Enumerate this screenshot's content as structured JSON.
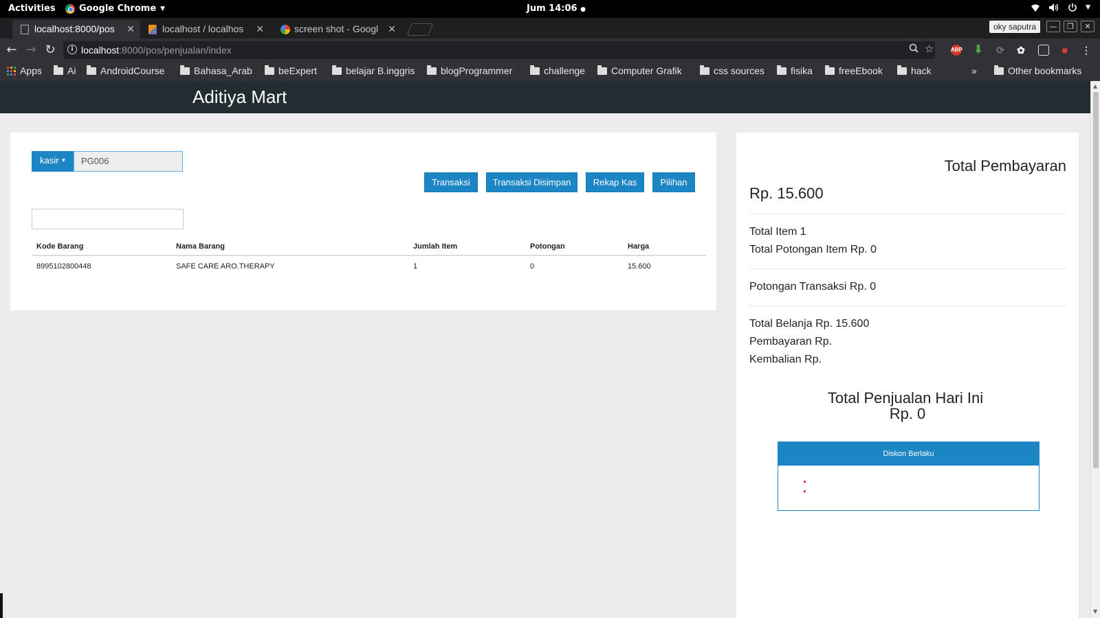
{
  "os": {
    "activities": "Activities",
    "app_name": "Google Chrome",
    "clock": "Jum 14:06"
  },
  "browser": {
    "tabs": [
      {
        "title": "localhost:8000/pos",
        "active": true,
        "icon": "document-icon"
      },
      {
        "title": "localhost / localhos",
        "active": false,
        "icon": "phpmyadmin-icon"
      },
      {
        "title": "screen shot - Googl",
        "active": false,
        "icon": "google-icon"
      }
    ],
    "profile": "oky saputra",
    "url_host": "localhost",
    "url_rest": ":8000/pos/penjualan/index",
    "bookmarks": [
      {
        "label": "Apps",
        "type": "apps"
      },
      {
        "label": "Ai",
        "type": "folder"
      },
      {
        "label": "AndroidCourse",
        "type": "folder"
      },
      {
        "label": "Bahasa_Arab",
        "type": "folder"
      },
      {
        "label": "beExpert",
        "type": "folder"
      },
      {
        "label": "belajar B.inggris",
        "type": "folder"
      },
      {
        "label": "blogProgrammer",
        "type": "folder"
      },
      {
        "label": "challenge",
        "type": "folder"
      },
      {
        "label": "Computer Grafik",
        "type": "folder"
      },
      {
        "label": "css sources",
        "type": "folder"
      },
      {
        "label": "fisika",
        "type": "folder"
      },
      {
        "label": "freeEbook",
        "type": "folder"
      },
      {
        "label": "hack",
        "type": "folder"
      }
    ],
    "overflow": "»",
    "other_bookmarks": "Other bookmarks"
  },
  "app": {
    "brand": "Aditiya Mart",
    "accent_color": "#1c85c4",
    "header_color": "#222d32"
  },
  "pos": {
    "kasir_label": "kasir",
    "kasir_value": "PG006",
    "search_value": "",
    "buttons": {
      "transaksi": "Transaksi",
      "transaksi_disimpan": "Transaksi Disimpan",
      "rekap_kas": "Rekap Kas",
      "pilihan": "Pilihan"
    },
    "columns": [
      "Kode Barang",
      "Nama Barang",
      "Jumlah Item",
      "Potongan",
      "Harga"
    ],
    "rows": [
      [
        "8995102800448",
        "SAFE CARE ARO.THERAPY",
        "1",
        "0",
        "15.600"
      ]
    ]
  },
  "summary": {
    "title": "Total Pembayaran",
    "total": "Rp. 15.600",
    "total_item": "Total Item 1",
    "total_potongan_item": "Total Potongan Item Rp. 0",
    "potongan_transaksi": "Potongan Transaksi Rp. 0",
    "total_belanja": "Total Belanja Rp. 15.600",
    "pembayaran": "Pembayaran Rp.",
    "kembalian": "Kembalian Rp.",
    "penjualan_title": "Total Penjualan Hari Ini",
    "penjualan_value": "Rp. 0",
    "diskon_title": "Diskon Berlaku"
  }
}
